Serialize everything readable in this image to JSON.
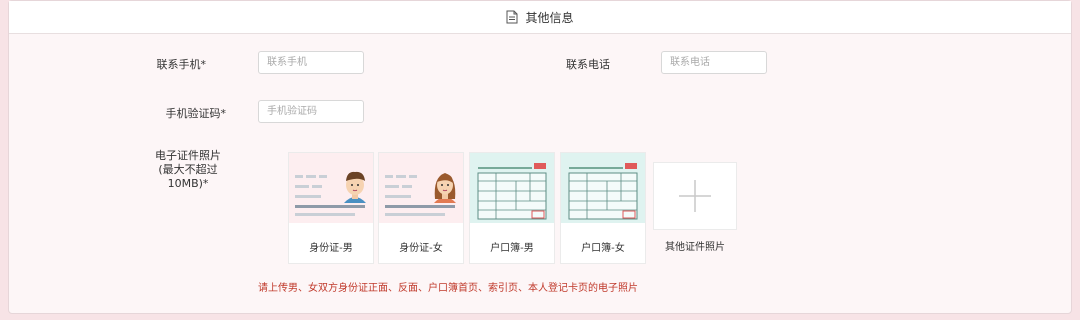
{
  "header": {
    "title": "其他信息",
    "icon": "document-icon"
  },
  "form": {
    "mobile": {
      "label": "联系手机*",
      "placeholder": "联系手机"
    },
    "phone": {
      "label": "联系电话",
      "placeholder": "联系电话"
    },
    "code": {
      "label": "手机验证码*",
      "placeholder": "手机验证码"
    },
    "photos": {
      "label_line1": "电子证件照片",
      "label_line2": "(最大不超过10MB)*",
      "cards": [
        {
          "caption": "身份证-男",
          "icon": "id-card-male-icon"
        },
        {
          "caption": "身份证-女",
          "icon": "id-card-female-icon"
        },
        {
          "caption": "户口簿-男",
          "icon": "household-register-icon"
        },
        {
          "caption": "户口簿-女",
          "icon": "household-register-icon"
        }
      ],
      "other": {
        "caption": "其他证件照片",
        "icon": "plus-icon"
      }
    },
    "note": "请上传男、女双方身份证正面、反面、户口簿首页、索引页、本人登记卡页的电子照片"
  },
  "colors": {
    "background": "#f7e3e6",
    "note": "#c0392b",
    "card_teal": "#dff3f0"
  }
}
